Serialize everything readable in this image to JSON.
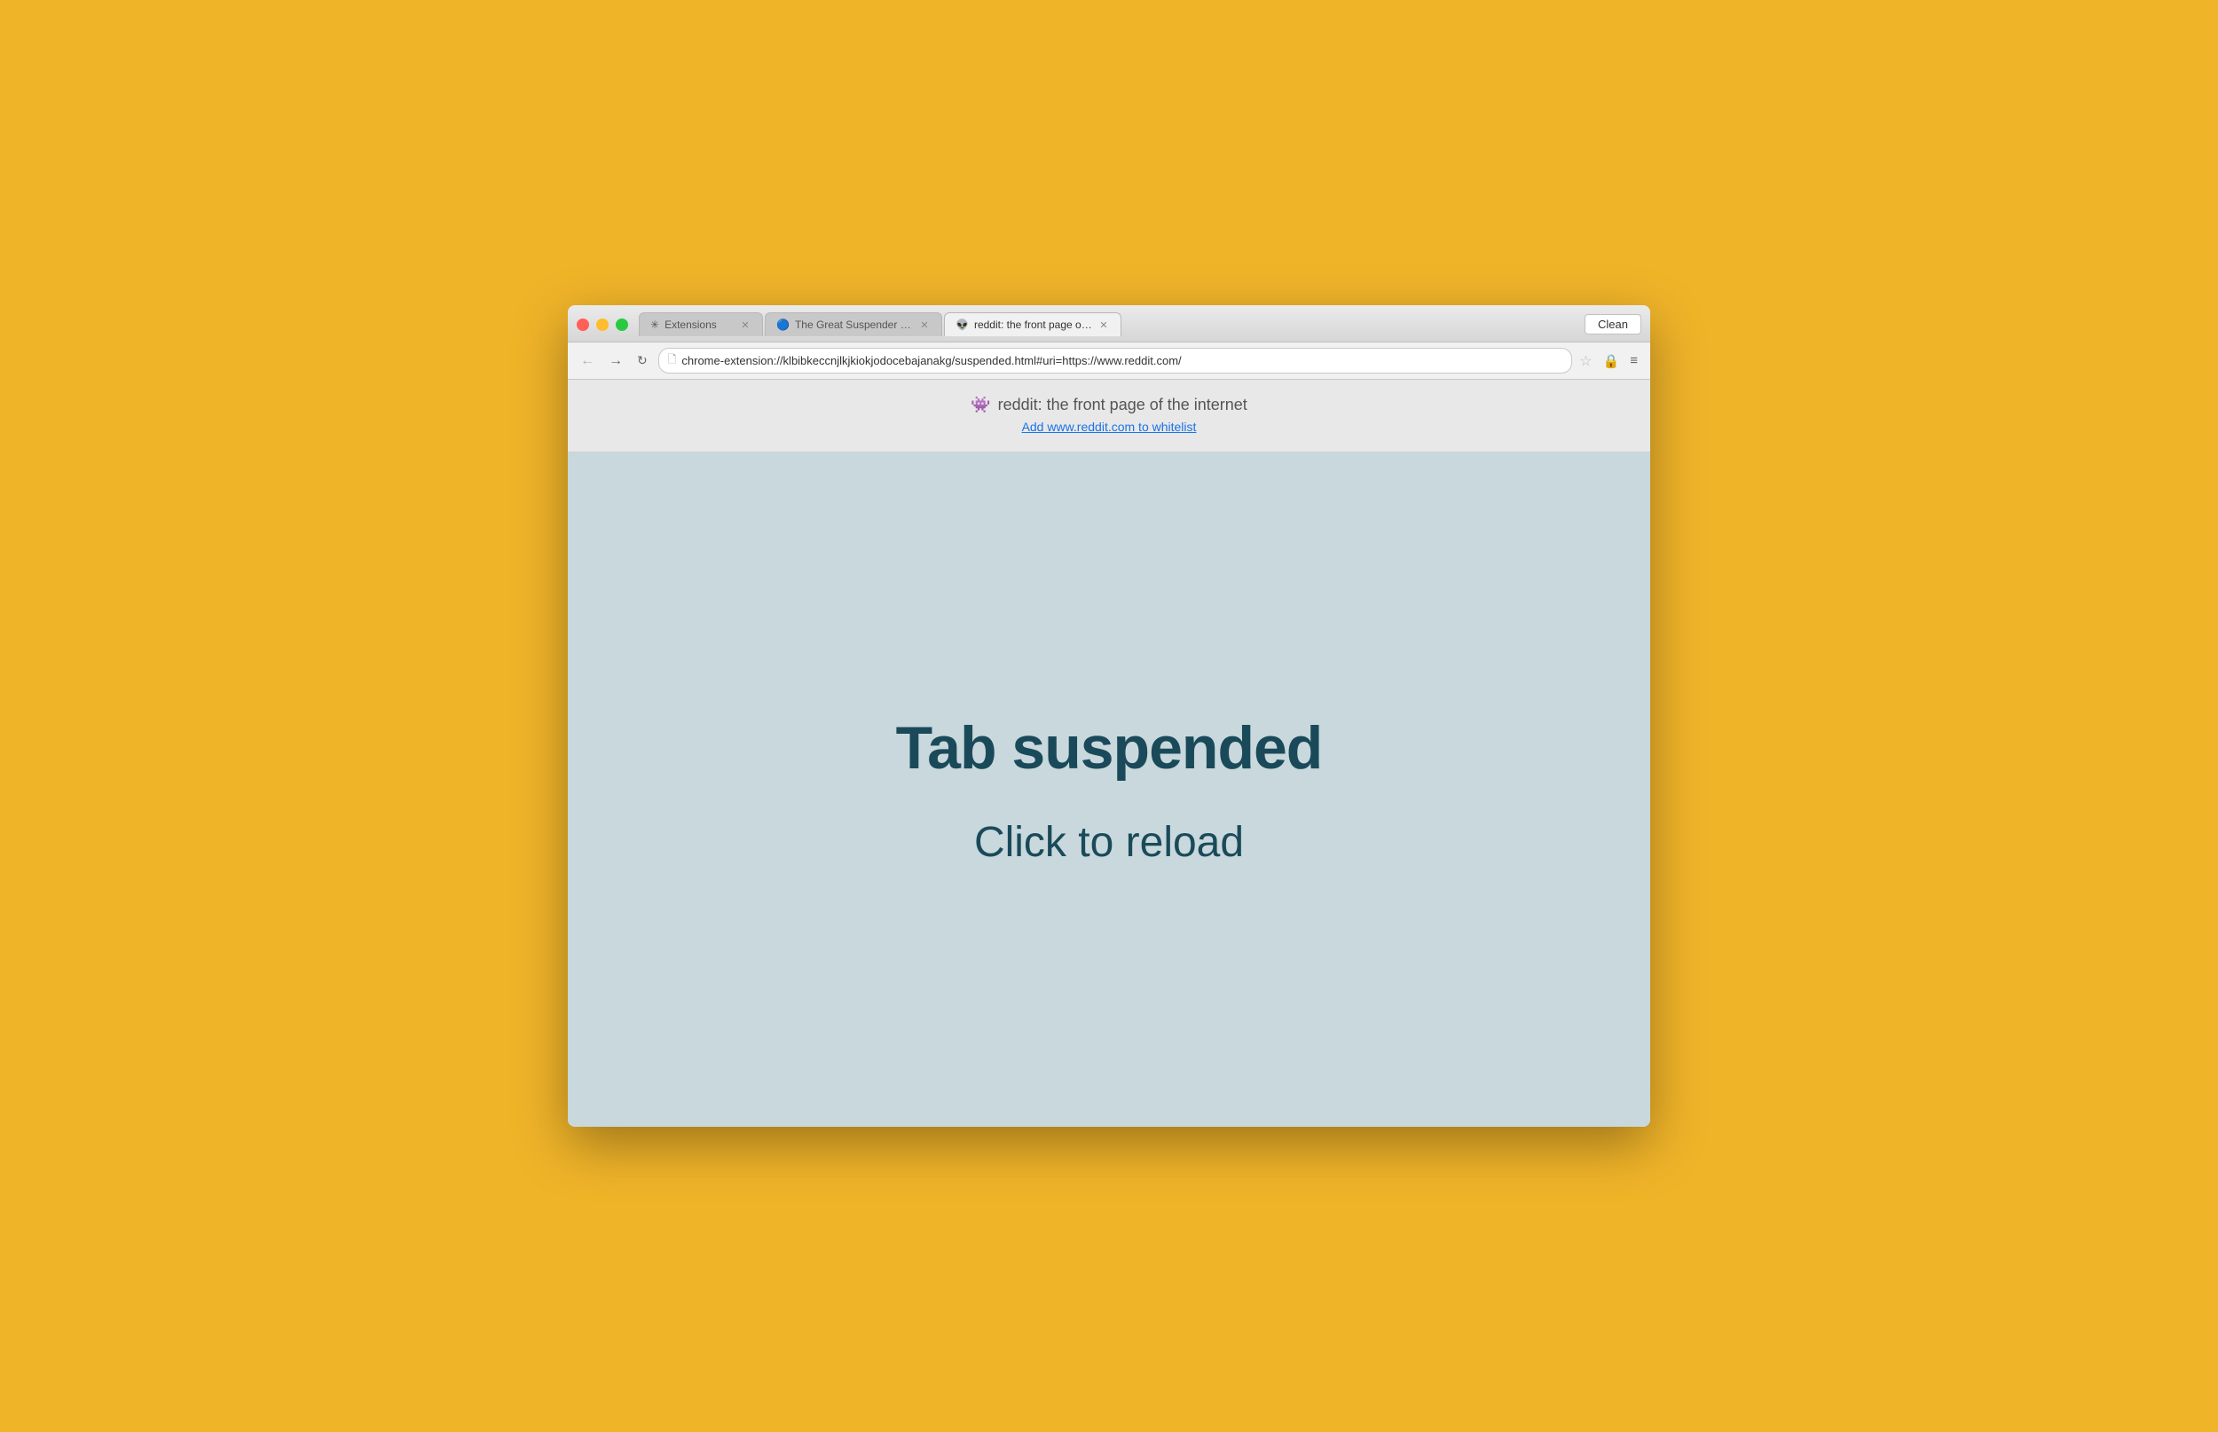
{
  "window": {
    "background_color": "#F0B429"
  },
  "browser": {
    "clean_button_label": "Clean",
    "tabs": [
      {
        "id": "tab-extensions",
        "label": "Extensions",
        "icon": "⚙",
        "active": false
      },
      {
        "id": "tab-great-suspender",
        "label": "The Great Suspender - Ch…",
        "icon": "🌀",
        "active": false
      },
      {
        "id": "tab-reddit",
        "label": "reddit: the front page of th…",
        "icon": "👽",
        "active": true
      }
    ],
    "address_bar": {
      "url": "chrome-extension://klbibkeccnjlkjkiokjodocebajanakg/suspended.html#uri=https://www.reddit.com/",
      "placeholder": ""
    }
  },
  "page_header": {
    "site_icon": "👾",
    "site_title": "reddit: the front page of the internet",
    "whitelist_link_text": "Add www.reddit.com to whitelist"
  },
  "page_content": {
    "heading": "Tab suspended",
    "subheading": "Click to reload"
  }
}
